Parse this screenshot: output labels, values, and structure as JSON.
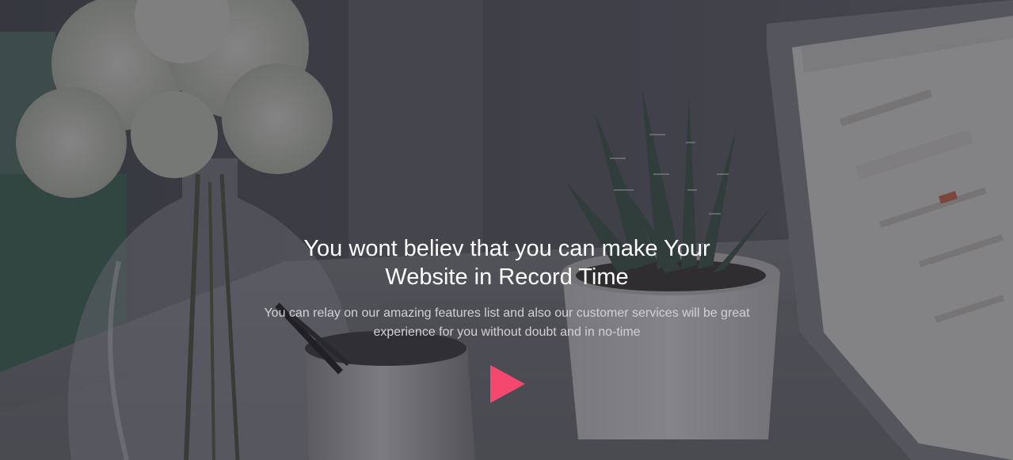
{
  "hero": {
    "title": "You wont believ that you can make Your Website in Record Time",
    "subtitle": "You can relay on our amazing features list and also our customer services will be great experience for you without doubt and in no-time",
    "play_icon": "play-icon",
    "background_image": "photo-desk-flowers-plant-laptop"
  },
  "colors": {
    "accent": "#f5486f",
    "overlay": "#262630",
    "title_text": "#ffffff",
    "subtitle_text": "#d2d2d6"
  }
}
